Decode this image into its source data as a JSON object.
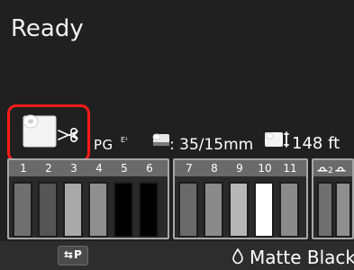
{
  "header": {
    "status": "Ready"
  },
  "media": {
    "mode": "PG",
    "mode_superscript": "E¹",
    "dimensions": ": 35/15mm",
    "remaining_length": "148 ft"
  },
  "ink": {
    "groups": [
      {
        "labels": [
          "1",
          "2",
          "3",
          "4",
          "5",
          "6"
        ]
      },
      {
        "labels": [
          "7",
          "8",
          "9",
          "10",
          "11"
        ]
      },
      {
        "labels": [
          "2",
          "2"
        ]
      }
    ]
  },
  "bottom": {
    "swap_label": "⇆P",
    "ink_type": "Matte Black"
  },
  "colors": {
    "highlight": "#ff1a1a",
    "panel_border": "#a7a7a7",
    "panel_header": "#6a6a6a"
  },
  "icons": {
    "roll": "roll-paper-icon",
    "scissors": "scissors-icon",
    "small_roll": "small-roll-icon",
    "length": "roll-length-icon",
    "drop": "ink-drop-icon",
    "swap": "swap-icon"
  }
}
